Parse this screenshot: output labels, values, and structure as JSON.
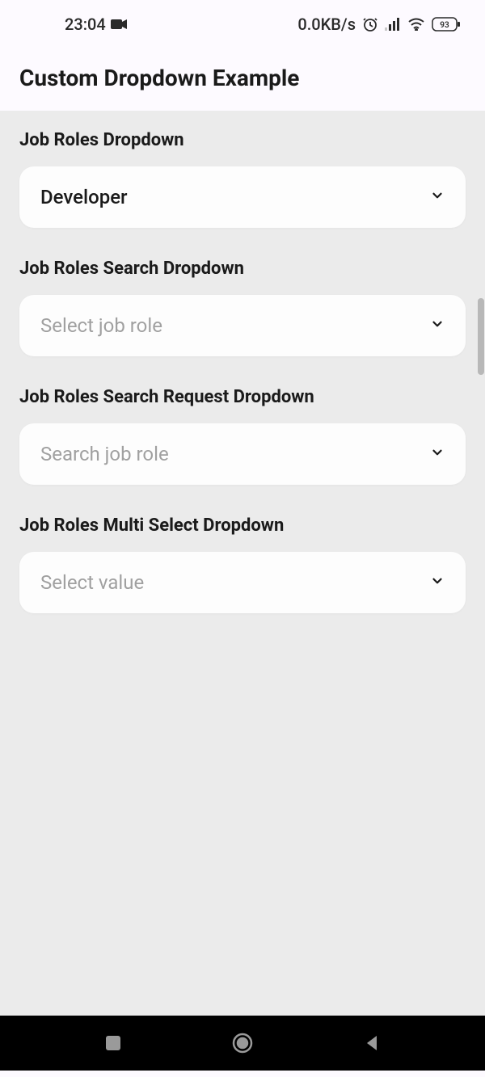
{
  "status": {
    "time": "23:04",
    "network": "0.0KB/s",
    "battery": "93"
  },
  "header": {
    "title": "Custom Dropdown Example"
  },
  "sections": [
    {
      "label": "Job Roles Dropdown",
      "value": "Developer",
      "isPlaceholder": false
    },
    {
      "label": "Job Roles Search Dropdown",
      "value": "Select job role",
      "isPlaceholder": true
    },
    {
      "label": "Job Roles Search Request Dropdown",
      "value": "Search job role",
      "isPlaceholder": true
    },
    {
      "label": "Job Roles Multi Select Dropdown",
      "value": "Select value",
      "isPlaceholder": true
    }
  ]
}
